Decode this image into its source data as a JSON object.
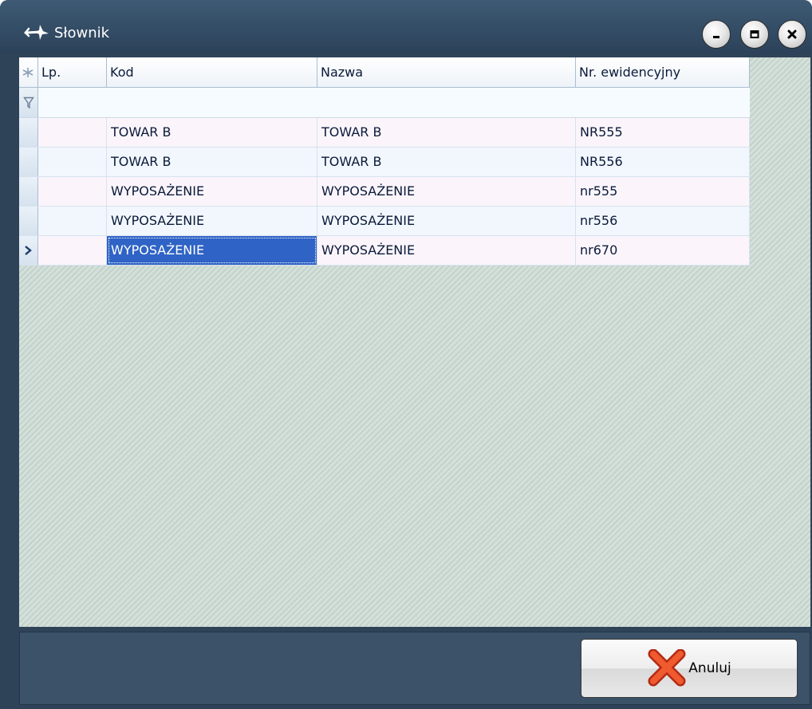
{
  "window": {
    "title": "Słownik",
    "controls": [
      "minimize",
      "maximize",
      "close"
    ]
  },
  "grid": {
    "columns": [
      {
        "key": "lp",
        "label": "Lp."
      },
      {
        "key": "kod",
        "label": "Kod"
      },
      {
        "key": "nazwa",
        "label": "Nazwa"
      },
      {
        "key": "nr",
        "label": "Nr. ewidencyjny"
      }
    ],
    "rows": [
      {
        "lp": "",
        "kod": "TOWAR B",
        "nazwa": "TOWAR B",
        "nr": "NR555"
      },
      {
        "lp": "",
        "kod": "TOWAR B",
        "nazwa": "TOWAR B",
        "nr": "NR556"
      },
      {
        "lp": "",
        "kod": "WYPOSAŻENIE",
        "nazwa": "WYPOSAŻENIE",
        "nr": "nr555"
      },
      {
        "lp": "",
        "kod": "WYPOSAŻENIE",
        "nazwa": "WYPOSAŻENIE",
        "nr": "nr556"
      },
      {
        "lp": "",
        "kod": "WYPOSAŻENIE",
        "nazwa": "WYPOSAŻENIE",
        "nr": "nr670"
      }
    ],
    "current_row": 4,
    "selected_column": "kod"
  },
  "footer": {
    "cancel_label": "Anuluj"
  },
  "colors": {
    "selection": "#2f63c6",
    "window_frame": "#2f4358"
  }
}
